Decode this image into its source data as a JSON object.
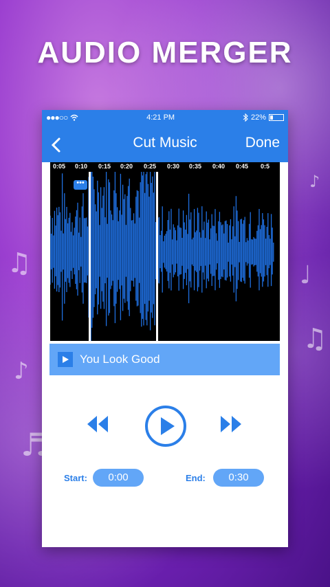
{
  "banner": {
    "title": "AUDIO MERGER"
  },
  "status_bar": {
    "signal": "●●●○○",
    "time": "4:21 PM",
    "battery": "22%",
    "battery_level": 0.22
  },
  "nav": {
    "title": "Cut Music",
    "done_label": "Done",
    "back_icon": "chevron-left-icon"
  },
  "timeline": {
    "ticks": [
      "0:05",
      "0:10",
      "0:15",
      "0:20",
      "0:25",
      "0:30",
      "0:35",
      "0:40",
      "0:45",
      "0:5"
    ]
  },
  "track": {
    "name": "You Look Good",
    "play_icon": "play-icon"
  },
  "controls": {
    "rewind_icon": "rewind-icon",
    "play_icon": "play-circle-icon",
    "forward_icon": "fast-forward-icon"
  },
  "range": {
    "start_label": "Start:",
    "start_value": "0:00",
    "end_label": "End:",
    "end_value": "0:30"
  },
  "colors": {
    "accent": "#2b7fe8",
    "accent_light": "#62a6f7",
    "wave": "#1f6fe0"
  }
}
